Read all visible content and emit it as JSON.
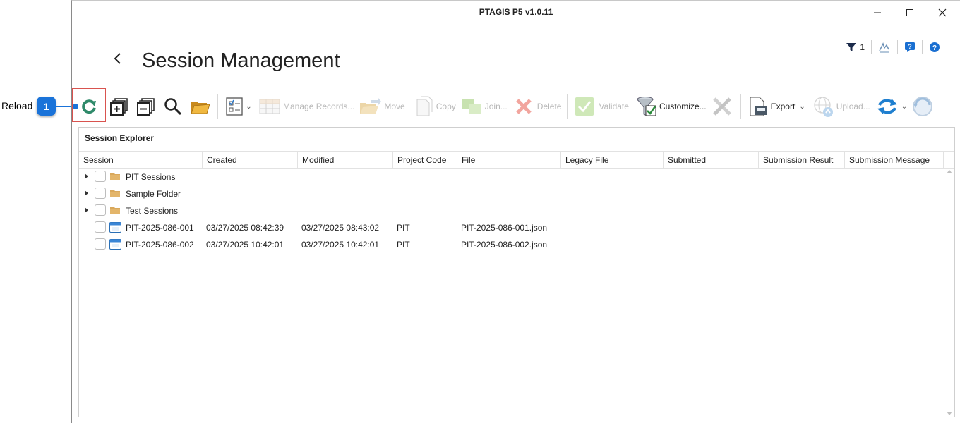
{
  "callout": {
    "label": "Reload",
    "badge": "1"
  },
  "window": {
    "title": "PTAGIS P5 v1.0.11"
  },
  "header": {
    "back_icon": "chevron-left-icon",
    "title": "Session Management",
    "filter_count": "1"
  },
  "toolbar": {
    "reload_icon": "refresh-icon",
    "manage_records": "Manage Records...",
    "move": "Move",
    "copy": "Copy",
    "join": "Join...",
    "delete": "Delete",
    "validate": "Validate",
    "customize": "Customize...",
    "export": "Export",
    "upload": "Upload..."
  },
  "explorer": {
    "title": "Session Explorer",
    "columns": [
      "Session",
      "Created",
      "Modified",
      "Project Code",
      "File",
      "Legacy File",
      "Submitted",
      "Submission Result",
      "Submission Message"
    ],
    "folders": [
      {
        "name": "PIT Sessions"
      },
      {
        "name": "Sample Folder"
      },
      {
        "name": "Test Sessions"
      }
    ],
    "sessions": [
      {
        "name": "PIT-2025-086-001",
        "created": "03/27/2025 08:42:39",
        "modified": "03/27/2025 08:43:02",
        "project": "PIT",
        "file": "PIT-2025-086-001.json"
      },
      {
        "name": "PIT-2025-086-002",
        "created": "03/27/2025 10:42:01",
        "modified": "03/27/2025 10:42:01",
        "project": "PIT",
        "file": "PIT-2025-086-002.json"
      }
    ]
  },
  "colors": {
    "accent": "#1a73d9",
    "highlight": "#d9534f",
    "folder": "#d9a85b",
    "refresh": "#1f7fcf"
  }
}
